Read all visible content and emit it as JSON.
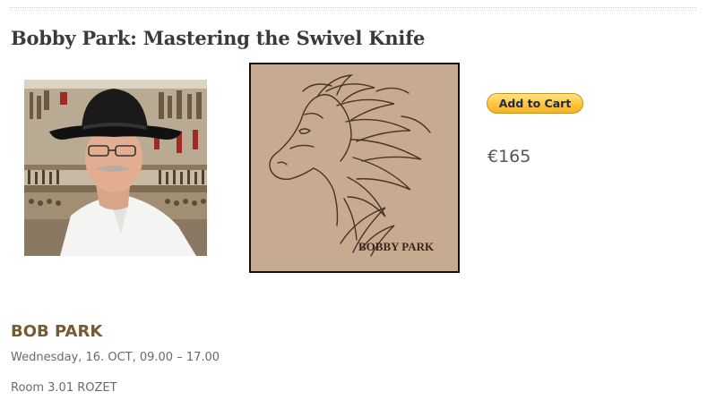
{
  "workshop": {
    "title": "Bobby Park: Mastering the Swivel Knife",
    "presenter": "BOB PARK",
    "schedule": "Wednesday, 16. OCT, 09.00 – 17.00",
    "room": "Room 3.01 ROZET"
  },
  "artwork": {
    "signature": "BOBBY PARK",
    "subject": "horse-head-carving"
  },
  "purchase": {
    "add_to_cart_label": "Add to Cart",
    "price": "€165"
  },
  "colors": {
    "title": "#3a3a3a",
    "presenter": "#7a5a32",
    "button": "#ffc439",
    "leather": "#c4a98e"
  }
}
